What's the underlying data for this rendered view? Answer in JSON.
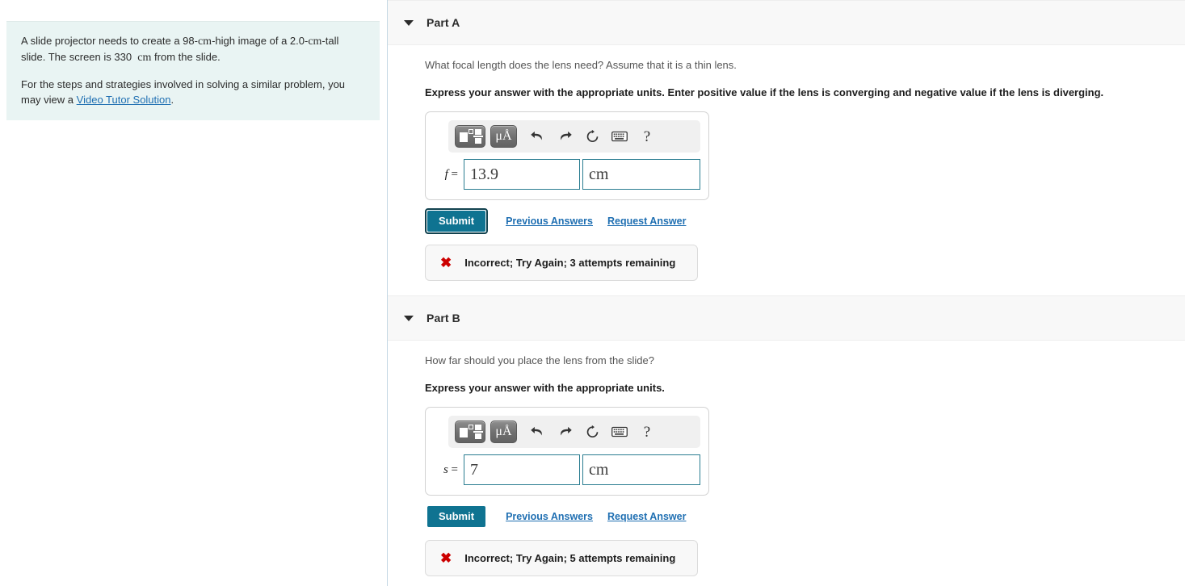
{
  "problem": {
    "paragraph_1_pre": "A slide projector needs to create a 98-",
    "paragraph_1_unit_a": "cm",
    "paragraph_1_mid": "-high image of a 2.0-",
    "paragraph_1_unit_b": "cm",
    "paragraph_1_post": "-tall slide. The screen is 330",
    "paragraph_1_unit_c": "cm",
    "paragraph_1_end": "from the slide.",
    "paragraph_2_pre": "For the steps and strategies involved in solving a similar problem, you may view a",
    "link_label": "Video Tutor Solution",
    "paragraph_2_post": "."
  },
  "toolbar": {
    "template_icon": "math-template-icon",
    "units_label": "μÅ",
    "undo_icon": "undo-icon",
    "redo_icon": "redo-icon",
    "reset_icon": "reset-icon",
    "keyboard_icon": "keyboard-icon",
    "help_label": "?"
  },
  "parts": [
    {
      "id": "part-a",
      "title": "Part A",
      "question": "What focal length does the lens need? Assume that it is a thin lens.",
      "instruction": "Express your answer with the appropriate units. Enter positive value if the lens is converging and negative value if the lens is diverging.",
      "variable": "f",
      "equals": "=",
      "answer_value": "13.9",
      "answer_unit": "cm",
      "submit_label": "Submit",
      "previous_answers_label": "Previous Answers",
      "request_answer_label": "Request Answer",
      "feedback_mark": "✖",
      "feedback_text": "Incorrect; Try Again; 3 attempts remaining",
      "submit_focused": true
    },
    {
      "id": "part-b",
      "title": "Part B",
      "question": "How far should you place the lens from the slide?",
      "instruction": "Express your answer with the appropriate units.",
      "variable": "s",
      "equals": "=",
      "answer_value": "7",
      "answer_unit": "cm",
      "submit_label": "Submit",
      "previous_answers_label": "Previous Answers",
      "request_answer_label": "Request Answer",
      "feedback_mark": "✖",
      "feedback_text": "Incorrect; Try Again; 5 attempts remaining",
      "submit_focused": false
    }
  ],
  "colors": {
    "accent_teal": "#0f7391",
    "link_blue": "#1f6fb2",
    "error_red": "#cc0000",
    "input_border": "#2a7d91",
    "problem_bg": "#e9f4f3",
    "band_bg": "#f8f8f8"
  }
}
